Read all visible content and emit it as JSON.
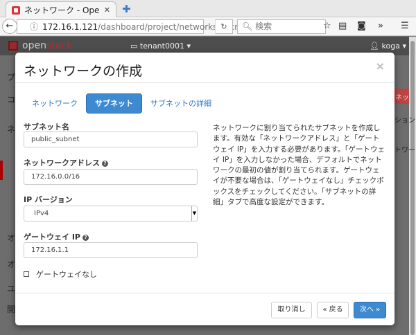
{
  "browser": {
    "tab_title": "ネットワーク - Open...",
    "tab_close": "✕",
    "new_tab": "✚",
    "url_host": "172.16.1.121",
    "url_path": "/dashboard/project/networks/#/crea",
    "search_placeholder": "検索"
  },
  "header": {
    "logo_open": "open",
    "logo_stack": "stack",
    "tenant": "tenant0001 ▾",
    "user": "koga ▾"
  },
  "background": {
    "left": [
      "プ",
      "コ",
      "ネ",
      "オ",
      "オ",
      "ユ",
      "開"
    ],
    "right": [
      "ネッ",
      "ション",
      "トワー"
    ]
  },
  "modal": {
    "title": "ネットワークの作成",
    "close": "×",
    "tabs": [
      {
        "label": "ネットワーク"
      },
      {
        "label": "サブネット"
      },
      {
        "label": "サブネットの詳細"
      }
    ],
    "fields": {
      "subnet_name_label": "サブネット名",
      "subnet_name_value": "public_subnet",
      "network_address_label": "ネットワークアドレス",
      "network_address_value": "172.16.0.0/16",
      "ip_version_label": "IP バージョン",
      "ip_version_value": "IPv4",
      "gateway_ip_label": "ゲートウェイ IP",
      "gateway_ip_value": "172.16.1.1",
      "no_gateway_label": "ゲートウェイなし"
    },
    "description": "ネットワークに割り当てられたサブネットを作成します。有効な「ネットワークアドレス」と「ゲートウェイ IP」を入力する必要があります。「ゲートウェイ IP」を入力しなかった場合、デフォルトでネットワークの最初の値が割り当てられます。ゲートウェイが不要な場合は、「ゲートウェイなし」チェックボックスをチェックしてください。「サブネットの詳細」タブで高度な設定ができます。",
    "buttons": {
      "cancel": "取り消し",
      "back": "« 戻る",
      "next": "次へ »"
    }
  }
}
